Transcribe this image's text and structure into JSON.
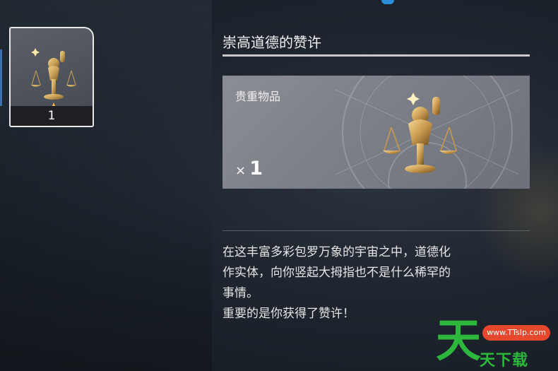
{
  "inventory": {
    "selected_slot": {
      "icon": "justice-scale-thumbs-up-icon",
      "count": "1"
    }
  },
  "item": {
    "name": "崇高道德的赞许",
    "rarity_label": "贵重物品",
    "quantity_prefix": "×",
    "quantity": "1",
    "icon": "justice-scale-thumbs-up-icon",
    "description_lines": [
      "在这丰富多彩包罗万象的宇宙之中，道德化",
      "作实体，向你竖起大拇指也不是什么稀罕的",
      "事情。",
      "重要的是你获得了赞许！"
    ]
  },
  "watermark": {
    "big_char": "天",
    "small_text": "天下载",
    "pill_text": "www.TTsIp.com"
  },
  "colors": {
    "accent_blue": "#2a8fd8",
    "card_gray": "#7b7e86",
    "watermark_green": "#2db83d",
    "watermark_red": "#e5482c",
    "gold": "#c9a25a"
  }
}
